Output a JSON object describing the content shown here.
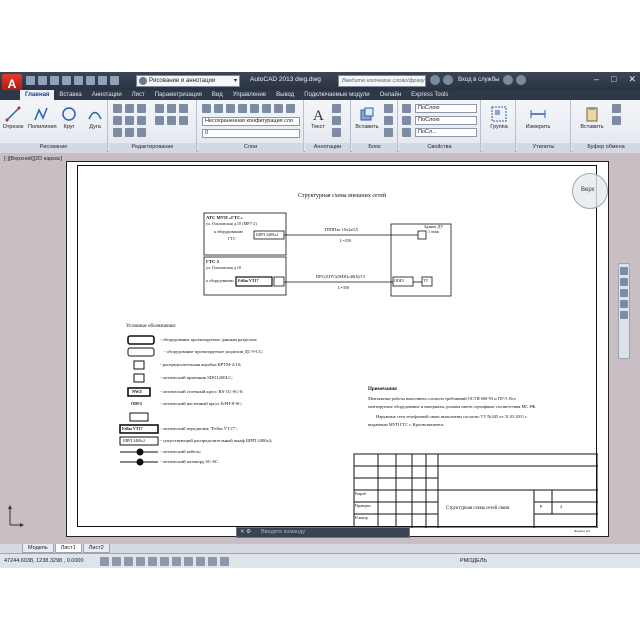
{
  "window": {
    "title": "AutoCAD 2013    dwg.dwg",
    "workspace": "Рисование и аннотации",
    "search_placeholder": "Введите ключевое слово/фразу",
    "login_label": "Вход в службы"
  },
  "ribbon_tabs": [
    {
      "label": "Главная",
      "active": true
    },
    {
      "label": "Вставка"
    },
    {
      "label": "Аннотации"
    },
    {
      "label": "Лист"
    },
    {
      "label": "Параметризация"
    },
    {
      "label": "Вид"
    },
    {
      "label": "Управление"
    },
    {
      "label": "Вывод"
    },
    {
      "label": "Подключаемые модули"
    },
    {
      "label": "Онлайн"
    },
    {
      "label": "Express Tools"
    }
  ],
  "panels": {
    "draw": {
      "title": "Рисование",
      "btn_line": "Отрезок",
      "btn_polyline": "Полилиния",
      "btn_circle": "Круг",
      "btn_arc": "Дуга"
    },
    "modify": {
      "title": "Редактирование"
    },
    "layers": {
      "title": "Слои",
      "layer_combo": "Несохраненная конфигурация сло",
      "layer_current": "0"
    },
    "annotation": {
      "title": "Аннотации",
      "btn_text": "Текст"
    },
    "block": {
      "title": "Блок",
      "btn_insert": "Вставить"
    },
    "properties": {
      "title": "Свойства",
      "color": "ПоСлою",
      "linetype": "ПоСлою",
      "lineweight": "ПоСл..."
    },
    "groups": {
      "title": "",
      "btn_group": "Группа"
    },
    "utilities": {
      "title": "Утилиты",
      "btn_measure": "Измерить"
    },
    "clipboard": {
      "title": "Буфер обмена",
      "btn_paste": "Вставить"
    }
  },
  "viewport": {
    "label": "[-][Верхний][2D каркас]",
    "viewcube": "Верх"
  },
  "drawing": {
    "title": "Структурная схема внешних сетей",
    "block1_l1": "АТС МУП «ГТС»",
    "block1_l2": "ул. Ольховская д.10 (МР7-2)",
    "block1_l3": "к оборудованию",
    "block1_l4": "ГТС",
    "block1_tag": "ШРП 2400х2",
    "block2_l1": "ГТС-2",
    "block2_l2": "ул. Ольховская д.10",
    "block2_l3": "к оборудованию",
    "block2_tag": "Fellas VT17",
    "line1_label": "ТПППэп 10х2х0,5",
    "line1_len": "L=250",
    "line2_label": "DPC(ZDV)(5HH)с48(6)/15",
    "line2_len": "L=350",
    "dest_l1": "Здание ДУ",
    "dest_l2": "1 этаж",
    "dest_odf": "ODF2",
    "dest_box": "ТV",
    "legend_title": "Условные обозначения:",
    "legend": [
      "- оборудование проектируемое данным разделом;",
      "- оборудование проектируемое разделом ДС-9-СС;",
      "- распределительная коробка КРТМ-2/10;",
      "- оптический приемник SDO1200LC;",
      "- оптический стоечный кросс RS-1U-SC-8;",
      "- оптический настенный кросс KPH-8-SC;",
      "- оптический передатчик \"Fellas VT17\";",
      "- существующий распределительный шкаф ШРП 2400х2;",
      "- оптический кабель;",
      "- оптический патчкорд SC-SC."
    ],
    "legend_tags": [
      "NWZ",
      "ODF2",
      "Fellas VT17",
      "ШРП 2400х2"
    ],
    "notes_title": "Примечания",
    "notes": [
      "Монтажные работы выполнить согласно требований ОСТН 600-93 и ПУЭ. Все",
      "монтируемое оборудование и материалы должны иметь сертификат соответствия МС РФ.",
      "Наружные сети телефонной связи выполнены согласно ТУ №345 от 31.03.2011 г.",
      "выданным МУП ГТС г. Краснознаменск."
    ],
    "stamp_title": "Структурная схема сетей связи",
    "stamp_stage": "Р",
    "stamp_sheet": "2",
    "stamp_rows": [
      "Разраб.",
      "Проверил",
      "Н.контр."
    ],
    "stamp_format": "Формат А3"
  },
  "command_line": {
    "placeholder": "Введите команду"
  },
  "layout_tabs": [
    {
      "label": "Модель"
    },
    {
      "label": "Лист1",
      "active": true
    },
    {
      "label": "Лист2"
    }
  ],
  "status": {
    "coords": "47244.6038, 1238.3298 , 0.0000",
    "mode": "РМОДЕЛЬ"
  }
}
